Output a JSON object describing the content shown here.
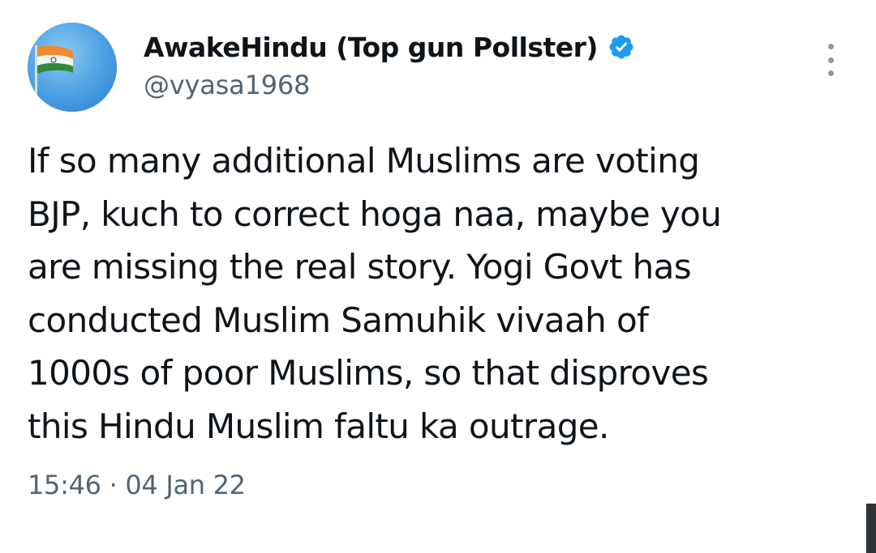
{
  "author": {
    "display_name": "AwakeHindu (Top gun Pollster)",
    "handle": "@vyasa1968",
    "verified": true,
    "avatar_icon": "indian-flag-avatar"
  },
  "tweet": {
    "text_lines": [
      "If so many additional Muslims are voting",
      "BJP, kuch to correct hoga naa, maybe you",
      "are missing the real story. Yogi Govt has",
      "conducted Muslim Samuhik vivaah of",
      "1000s of poor Muslims, so that disproves",
      "this Hindu Muslim faltu ka outrage."
    ],
    "timestamp": "15:46 · 04 Jan 22"
  },
  "icons": {
    "more": "more-vertical-icon",
    "verified": "verified-badge-icon"
  },
  "colors": {
    "text_primary": "#0f1419",
    "text_secondary": "#536471",
    "verified_blue": "#1d9bf0",
    "avatar_sky": "#3f98e0"
  }
}
